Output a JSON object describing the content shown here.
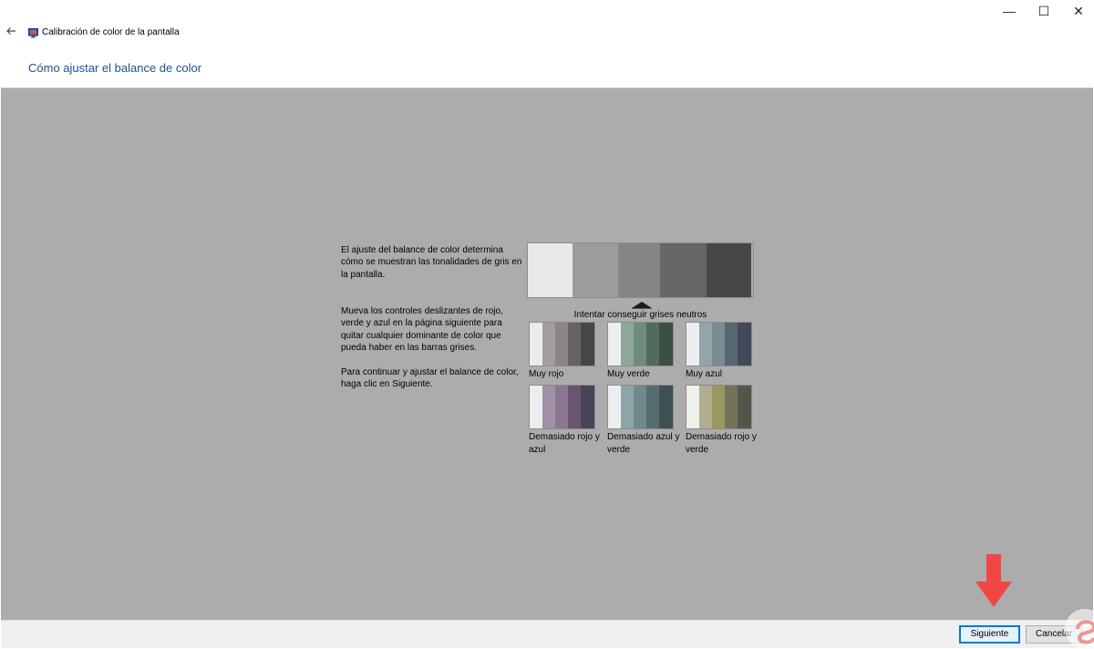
{
  "window": {
    "back_icon": "back-arrow-icon",
    "title": "Calibración de color de la pantalla",
    "minimize_glyph": "—",
    "maximize_glyph": "☐",
    "close_glyph": "✕"
  },
  "heading": "Cómo ajustar el balance de color",
  "instructions": {
    "para1": "El ajuste del balance de color determina cómo se muestran las tonalidades de gris en la pantalla.",
    "para2": "Mueva los controles deslizantes de rojo, verde y azul en la página siguiente para quitar cualquier dominante de color que pueda haber en las barras grises.",
    "para3": "Para continuar y ajustar el balance de color, haga clic en Siguiente."
  },
  "neutral": {
    "caption": "Intentar conseguir grises neutros",
    "colors": [
      "#e8e8e8",
      "#9c9c9c",
      "#858585",
      "#666666",
      "#474747"
    ]
  },
  "swatches": [
    {
      "label": "Muy rojo",
      "colors": [
        "#ececec",
        "#a39e9d",
        "#8a8685",
        "#666362",
        "#484645"
      ]
    },
    {
      "label": "Muy verde",
      "colors": [
        "#ecefec",
        "#8fa89a",
        "#6f8d7a",
        "#536b5c",
        "#3c4f43"
      ]
    },
    {
      "label": "Muy azul",
      "colors": [
        "#eceef0",
        "#95a4a8",
        "#778c93",
        "#56676f",
        "#42495a"
      ]
    },
    {
      "label": "Demasiado rojo y azul",
      "colors": [
        "#eeecee",
        "#a18fa6",
        "#897790",
        "#6a5571",
        "#474457"
      ]
    },
    {
      "label": "Demasiado azul y verde",
      "colors": [
        "#ecefef",
        "#8ea5a7",
        "#70898c",
        "#566d6f",
        "#3e5052"
      ]
    },
    {
      "label": "Demasiado rojo y verde",
      "colors": [
        "#efefec",
        "#b1ad90",
        "#999860",
        "#73735a",
        "#55554a"
      ]
    }
  ],
  "buttons": {
    "next": "Siguiente",
    "cancel": "Cancelar"
  },
  "colors": {
    "content_bg": "#acacac",
    "heading": "#1f4e96",
    "accent": "#0078d7",
    "annotation_arrow": "#f24545"
  }
}
